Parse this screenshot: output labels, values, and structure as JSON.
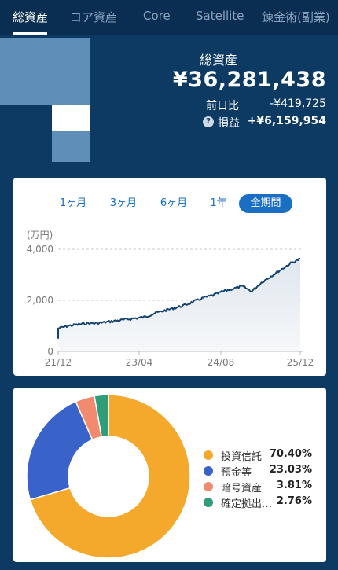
{
  "tabs": [
    {
      "label": "総資産"
    },
    {
      "label": "コア資産"
    },
    {
      "label": "Core"
    },
    {
      "label": "Satellite"
    },
    {
      "label": "錬金術(副業)"
    }
  ],
  "summary": {
    "title": "総資産",
    "total": "¥36,281,438",
    "day_change_label": "前日比",
    "day_change_value": "-¥419,725",
    "pl_label": "損益",
    "pl_value": "+¥6,159,954",
    "help_icon": "?"
  },
  "range_buttons": [
    "1ヶ月",
    "3ヶ月",
    "6ヶ月",
    "1年",
    "全期間"
  ],
  "selected_range": "全期間",
  "colors": {
    "line": "#14426f",
    "accent": "#1a6fc4",
    "invest": "#f4a92d",
    "deposit": "#3a63c9",
    "crypto": "#f28a6f",
    "dc": "#2f9c7a"
  },
  "chart_data": {
    "type": "area",
    "ylabel": "(万円)",
    "ylim": [
      0,
      4000
    ],
    "yticks": [
      "4,000",
      "2,000",
      "0"
    ],
    "xticks": [
      "21/12",
      "23/04",
      "24/08",
      "25/12"
    ],
    "x": [
      "21/12",
      "22/01",
      "22/02",
      "22/03",
      "22/05",
      "22/07",
      "22/09",
      "22/11",
      "23/01",
      "23/04",
      "23/06",
      "23/08",
      "23/10",
      "23/12",
      "24/02",
      "24/04",
      "24/06",
      "24/08",
      "24/10",
      "24/12",
      "25/02",
      "25/04",
      "25/06",
      "25/08",
      "25/10",
      "25/12"
    ],
    "series": [
      {
        "values": [
          900,
          1000,
          1050,
          1100,
          1100,
          1150,
          1200,
          1250,
          1300,
          1350,
          1500,
          1600,
          1700,
          1800,
          1950,
          2100,
          2200,
          2350,
          2450,
          2550,
          2350,
          2700,
          2950,
          3200,
          3450,
          3628
        ]
      }
    ]
  },
  "allocation": {
    "chart_data": {
      "type": "pie",
      "categories": [
        "投資信託",
        "預金等",
        "暗号資産",
        "確定拠出…"
      ],
      "values": [
        70.4,
        23.03,
        3.81,
        2.76
      ]
    },
    "legend": [
      {
        "name": "投資信託",
        "value": "70.40%"
      },
      {
        "name": "預金等",
        "value": "23.03%"
      },
      {
        "name": "暗号資産",
        "value": "3.81%"
      },
      {
        "name": "確定拠出…",
        "value": "2.76%"
      }
    ]
  }
}
